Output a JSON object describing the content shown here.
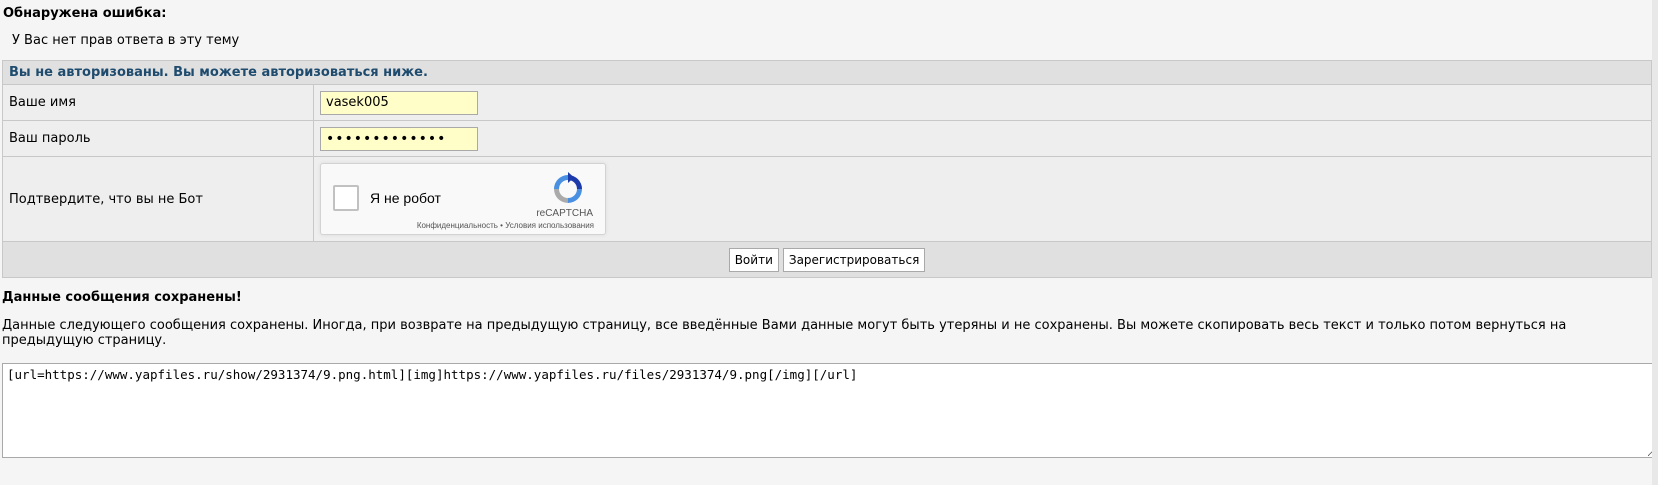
{
  "error": {
    "title": "Обнаружена ошибка:",
    "message": "У Вас нет прав ответа в эту тему"
  },
  "login": {
    "header": "Вы не авторизованы. Вы можете авторизоваться ниже.",
    "name_label": "Ваше имя",
    "name_value": "vasek005",
    "password_label": "Ваш пароль",
    "password_mask": "•••••••••••••",
    "captcha_label": "Подтвердите, что вы не Бот",
    "captcha": {
      "checkbox_text": "Я не робот",
      "brand": "reCAPTCHA",
      "links": "Конфиденциальность • Условия использования"
    },
    "login_button": "Войти",
    "register_button": "Зарегистрироваться"
  },
  "saved": {
    "title": "Данные сообщения сохранены!",
    "description": "Данные следующего сообщения сохранены. Иногда, при возврате на предыдущую страницу, все введённые Вами данные могут быть утеряны и не сохранены. Вы можете скопировать весь текст и только потом вернуться на предыдущую страницу.",
    "text": "[url=https://www.yapfiles.ru/show/2931374/9.png.html][img]https://www.yapfiles.ru/files/2931374/9.png[/img][/url]"
  },
  "colors": {
    "header_text": "#1e4b6e",
    "input_bg": "#fffdc8",
    "recaptcha_blue": "#4a90e2"
  }
}
